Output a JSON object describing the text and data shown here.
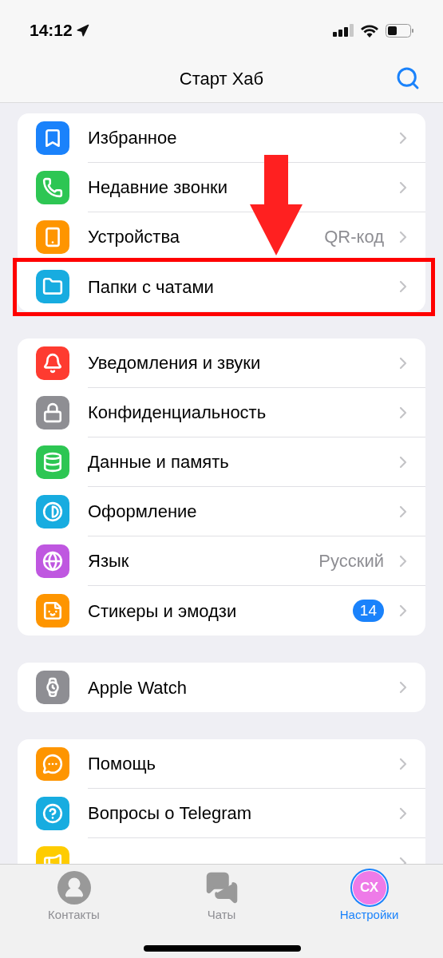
{
  "status_bar": {
    "time": "14:12"
  },
  "nav": {
    "title": "Старт Хаб"
  },
  "groups": [
    {
      "items": [
        {
          "label": "Избранное",
          "color": "#1a82fb",
          "highlighted": false
        },
        {
          "label": "Недавние звонки",
          "color": "#2dc653",
          "highlighted": false
        },
        {
          "label": "Устройства",
          "value": "QR-код",
          "color": "#fe9500",
          "highlighted": false
        },
        {
          "label": "Папки с чатами",
          "color": "#17ace0",
          "highlighted": true
        }
      ]
    },
    {
      "items": [
        {
          "label": "Уведомления и звуки",
          "color": "#fe3b30",
          "highlighted": false
        },
        {
          "label": "Конфиденциальность",
          "color": "#8e8e93",
          "highlighted": false
        },
        {
          "label": "Данные и память",
          "color": "#2dc653",
          "highlighted": false
        },
        {
          "label": "Оформление",
          "color": "#17ace0",
          "highlighted": false
        },
        {
          "label": "Язык",
          "value": "Русский",
          "color": "#bf57e0",
          "highlighted": false
        },
        {
          "label": "Стикеры и эмодзи",
          "badge": "14",
          "color": "#fe9500",
          "highlighted": false
        }
      ]
    },
    {
      "items": [
        {
          "label": "Apple Watch",
          "color": "#8e8e93",
          "highlighted": false
        }
      ]
    },
    {
      "items": [
        {
          "label": "Помощь",
          "color": "#fe9500",
          "highlighted": false
        },
        {
          "label": "Вопросы о Telegram",
          "color": "#17ace0",
          "highlighted": false
        },
        {
          "color": "#fecc00",
          "highlighted": false
        }
      ]
    }
  ],
  "tab_bar": [
    {
      "label": "Контакты",
      "selected": false
    },
    {
      "label": "Чаты",
      "selected": false
    },
    {
      "label": "Настройки",
      "avatar": "СХ",
      "selected": true
    }
  ]
}
